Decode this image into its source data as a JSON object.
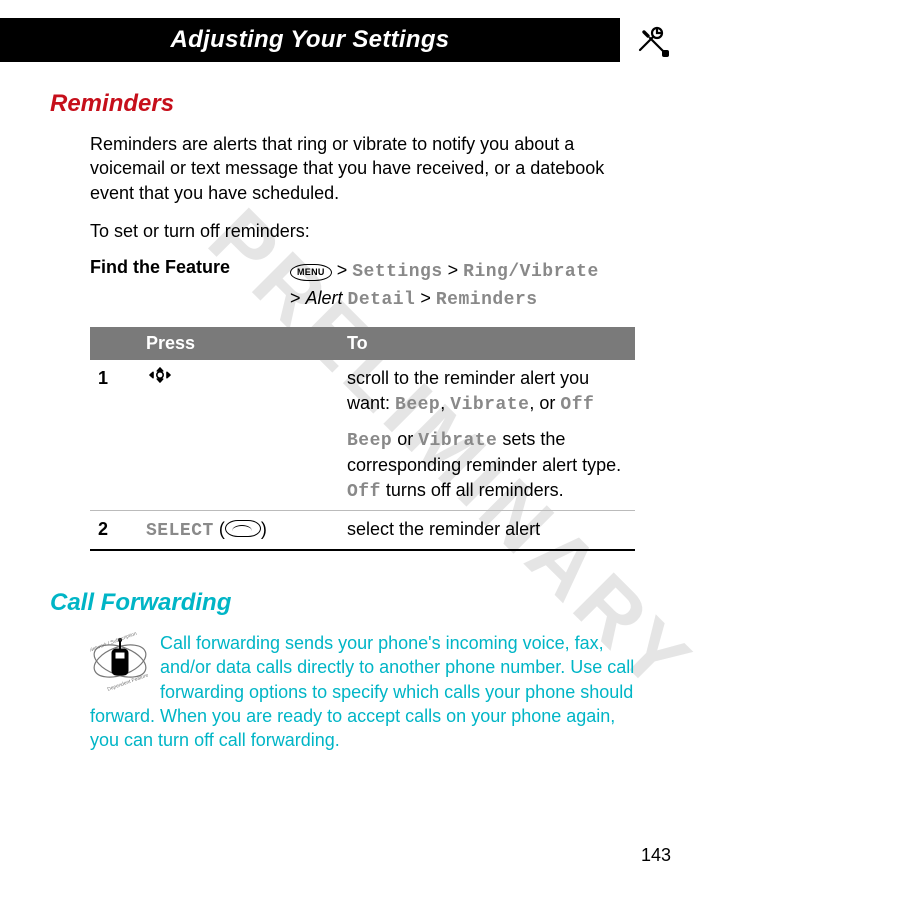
{
  "header": {
    "title": "Adjusting Your Settings"
  },
  "watermark": "PRELIMINARY",
  "reminders": {
    "heading": "Reminders",
    "intro": "Reminders are alerts that ring or vibrate to notify you about a voicemail or text message that you have received, or a datebook event that you have scheduled.",
    "lead": "To set or turn off reminders:",
    "find_the_feature_label": "Find the Feature",
    "menu_key_label": "MENU",
    "path_line1_items": {
      "gt1": " > ",
      "settings": "Settings",
      "gt2": " > ",
      "ringvibrate": "Ring/Vibrate"
    },
    "path_line2_items": {
      "gt1": "> ",
      "alert_italic": "Alert",
      "space": " ",
      "detail": "Detail",
      "gt2": " > ",
      "reminders": "Reminders"
    },
    "table": {
      "head_press": "Press",
      "head_to": "To",
      "rows": [
        {
          "num": "1",
          "press_glyph": "nav",
          "to_line1_pre": "scroll to the reminder alert you want: ",
          "to_line1_opt1": "Beep",
          "to_line1_sep1": ", ",
          "to_line1_opt2": "Vibrate",
          "to_line1_sep2": ", or ",
          "to_line1_opt3": "Off",
          "to_line2_opt1": "Beep",
          "to_line2_mid1": " or ",
          "to_line2_opt2": "Vibrate",
          "to_line2_mid2": " sets the corresponding reminder alert type. ",
          "to_line2_opt3": "Off",
          "to_line2_tail": " turns off all reminders."
        },
        {
          "num": "2",
          "press_select": "SELECT",
          "press_paren_open": " (",
          "press_paren_close": ")",
          "to_text": "select the reminder alert"
        }
      ]
    }
  },
  "call_forwarding": {
    "heading": "Call Forwarding",
    "body": "Call forwarding sends your phone's incoming voice, fax, and/or data calls directly to another phone number. Use call forwarding options to specify which calls your phone should forward. When you are ready to accept calls on your phone again, you can turn off call forwarding."
  },
  "page_number": "143"
}
